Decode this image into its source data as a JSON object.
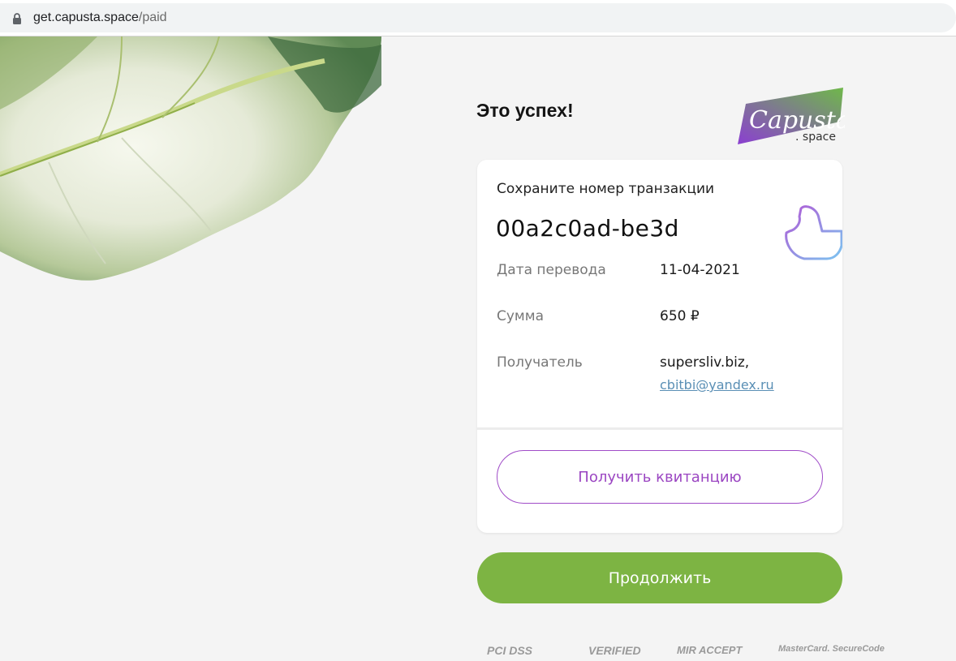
{
  "browser": {
    "url_host": "get.capusta.space",
    "url_path": "/paid"
  },
  "header": {
    "title": "Это успех!",
    "logo_text": "Capusta",
    "logo_suffix": ". space"
  },
  "card": {
    "save_label": "Сохраните номер транзакции",
    "transaction_id": "00a2c0ad-be3d",
    "rows": [
      {
        "label": "Дата перевода",
        "value": "11-04-2021"
      },
      {
        "label": "Сумма",
        "value": "650 ₽"
      },
      {
        "label": "Получатель",
        "value": "supersliv.biz,",
        "link": "cbitbi@yandex.ru"
      }
    ],
    "receipt_button": "Получить квитанцию"
  },
  "continue_button": "Продолжить",
  "badges": [
    "PCI DSS",
    "VERIFIED",
    "MIR ACCEPT",
    "MasterCard. SecureCode"
  ],
  "colors": {
    "accent_green": "#7db443",
    "accent_purple": "#9b46c2",
    "link_blue": "#5a8fb5",
    "background": "#f4f4f4"
  },
  "icons": [
    "lock-icon",
    "thumbs-up-icon",
    "capusta-logo"
  ]
}
